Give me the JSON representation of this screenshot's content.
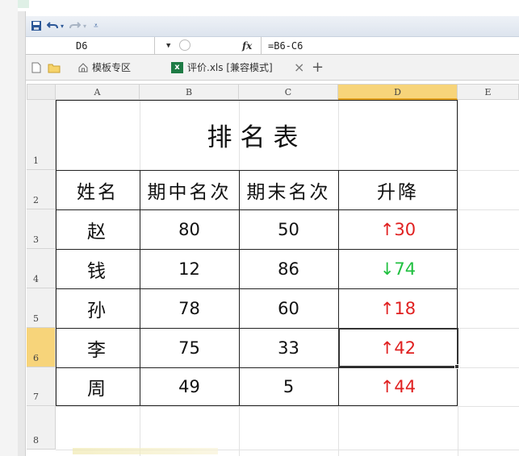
{
  "formula_bar": {
    "name_box": "D6",
    "fx_label": "fx",
    "formula": "=B6-C6"
  },
  "tab_bar": {
    "tabs": [
      {
        "label": "模板专区"
      },
      {
        "label": "评价.xls [兼容模式]"
      }
    ],
    "close_glyph": "×",
    "add_glyph": "+"
  },
  "columns": [
    "A",
    "B",
    "C",
    "D",
    "E"
  ],
  "rows": [
    "1",
    "2",
    "3",
    "4",
    "5",
    "6",
    "7",
    "8"
  ],
  "table": {
    "title": "排名表",
    "headers": [
      "姓名",
      "期中名次",
      "期末名次",
      "升降"
    ],
    "rows": [
      {
        "name": "赵",
        "mid": "80",
        "final": "50",
        "change": "↑30",
        "direction": "up"
      },
      {
        "name": "钱",
        "mid": "12",
        "final": "86",
        "change": "↓74",
        "direction": "down"
      },
      {
        "name": "孙",
        "mid": "78",
        "final": "60",
        "change": "↑18",
        "direction": "up"
      },
      {
        "name": "李",
        "mid": "75",
        "final": "33",
        "change": "↑42",
        "direction": "up"
      },
      {
        "name": "周",
        "mid": "49",
        "final": "5",
        "change": "↑44",
        "direction": "up"
      }
    ]
  },
  "colors": {
    "up": "#e02020",
    "down": "#20c040",
    "selected_header": "#f7d47a"
  },
  "selection": {
    "cell": "D6"
  }
}
